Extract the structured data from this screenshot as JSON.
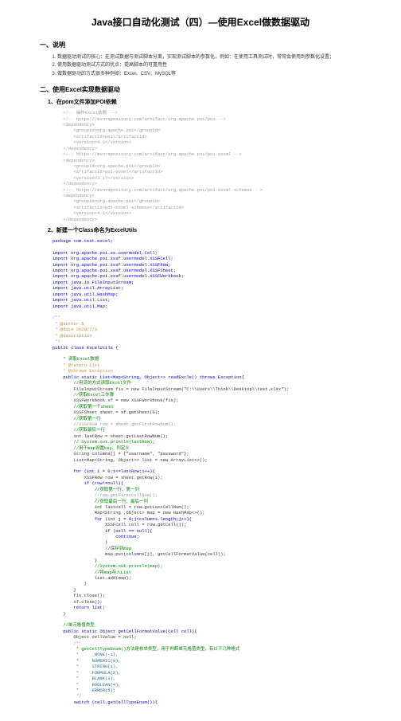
{
  "title": "Java接口自动化测试（四）—使用Excel做数据驱动",
  "s1": {
    "heading": "一、说明",
    "items": [
      "数据驱动测试的核心：在测试数据与测试脚本分离，实现测试脚本的参数化，例如：在使用工具测试时，常常会使用到参数化设置；",
      "使用数据驱动测试方式的优点：提高脚本的可重用性",
      "做数据驱动的方式很多种例如：Excel、CSV、MySQL等"
    ]
  },
  "s2": {
    "heading": "二、使用Excel实现数据驱动",
    "sub1": "1、在pom文件添加POI依赖",
    "sub2": "2、新建一个Class命名为ExcelUtils",
    "pom": "    <!-- 操作Excel依赖 -->\n    <!-- https://mvnrepository.com/artifact/org.apache.poi/poi -->\n    <dependency>\n        <groupId>org.apache.poi</groupId>\n        <artifactId>poi</artifactId>\n        <version>4.1</version>\n    </dependency>\n    <!-- https://mvnrepository.com/artifact/org.apache.poi/poi-ooxml -->\n    <dependency>\n        <groupId>org.apache.poi</groupId>\n        <artifactId>poi-ooxml</artifactId>\n        <version>3.17</version>\n    </dependency>\n    <!-- https://mvnrepository.com/artifact/org.apache.poi/poi-ooxml-schemas -->\n    <dependency>\n        <groupId>org.apache.poi</groupId>\n        <artifactId>poi-ooxml-schemas</artifactId>\n        <version>4.1</version>\n    </dependency>",
    "pkg": "package com.test.excel;",
    "imports": [
      "import org.apache.poi.ss.usermodel.Cell;",
      "import org.apache.poi.xssf.usermodel.XSSFCell;",
      "import org.apache.poi.xssf.usermodel.XSSFRow;",
      "import org.apache.poi.xssf.usermodel.XSSFSheet;",
      "import org.apache.poi.xssf.usermodel.XSSFWorkbook;",
      "import java.io.FileInputStream;",
      "import java.util.ArrayList;",
      "import java.util.HashMap;",
      "import java.util.List;",
      "import java.util.Map;"
    ],
    "doc": {
      "l1": "/**",
      "l2": " * @author $",
      "l3": " * @date 2020/7/3",
      "l4": " * @description",
      "l5": " */"
    },
    "classDecl": "public class ExcelUtils {",
    "m1cmt": {
      "l1": "    * 读取Excel数据",
      "l2": "    * @return List",
      "l3": "    * @throws Exception"
    },
    "m1sig": "    public static List<Map<String, Object>> readExcle() throws Exception{",
    "body": {
      "l1": "        //用流的方式读取Excel文件",
      "l2": "        FileInputStream fis = new FileInputStream(\"C:\\\\Users\\\\Think\\\\Desktop\\\\test.xlsx\");",
      "l3": "        //获取Excel工作簿",
      "l4": "        XSSFWorkbook xf = new XSSFWorkbook(fis);",
      "l5": "        //获取第一个sheet",
      "l6": "        XSSFSheet sheet = xf.getSheet(0);",
      "l7": "        //获取第一行",
      "l8": "        //XSSFRow row = sheet.getFirstRowNum();",
      "l9": "        //获取最后一行",
      "l10": "        int lastRow = sheet.getLastRowNum();",
      "l11": "        // System.out.println(lastRow);",
      "l12": "        //用于map设置key、列定义",
      "l13": "        String columns[] = {\"username\", \"password\"};",
      "l14": "        List<Map<String, Object>> list = new ArrayList<>();",
      "l15": "        for (int i = 0;i<=lastRow;i++){",
      "l16": "            XSSFRow row = sheet.getRow(i);",
      "l17": "            if (row!=null){",
      "l18": "                //获取第一行、第一列",
      "l19": "                //row.getFirstCellNum();",
      "l20": "                //获取最后一行、最后一列",
      "l21": "                int lastcell = row.getLastCellNum();",
      "l22": "                Map<String ,Object> map = new HashMap<>();",
      "l23": "                for (int j = 0;j<columns.length;j++){",
      "l24": "                    XSSFCell cell = row.getCell(j);",
      "l25": "                    if (cell == null){",
      "l26": "                        continue;",
      "l27": "                    }",
      "l28": "                    //保存到map",
      "l29": "                    map.put(columns[j], getCellFormatValue(cell));",
      "l30": "                }",
      "l31": "                //System.out.println(map);",
      "l32": "                //将map存入List",
      "l33": "                list.add(map);",
      "l34": "            }",
      "l35": "        }",
      "l36": "        fis.close();",
      "l37": "        xf.close();",
      "l38": "        return list;",
      "l39": "    }"
    },
    "m2cmt": "    //单元格值类型",
    "m2sig": "    public static Object getCellFormatValue(Cell cell){",
    "m2body": {
      "l1": "        Object cellValue = null;",
      "l2": "        /**",
      "l3": "         * getCellTypeEnum()方法是枚举类型，用于判断单元格值类型，有以下几种格式",
      "l4": "         *     _NONE(-1),",
      "l5": "         *     NUMERIC(0),",
      "l6": "         *     STRING(1),",
      "l7": "         *     FORMULA(2),",
      "l8": "         *     BLANK(3),",
      "l9": "         *     BOOLEAN(4),",
      "l10": "         *     ERROR(5);",
      "l11": "         */",
      "l12": "        switch (cell.getCellTypeEnum()){"
    }
  }
}
